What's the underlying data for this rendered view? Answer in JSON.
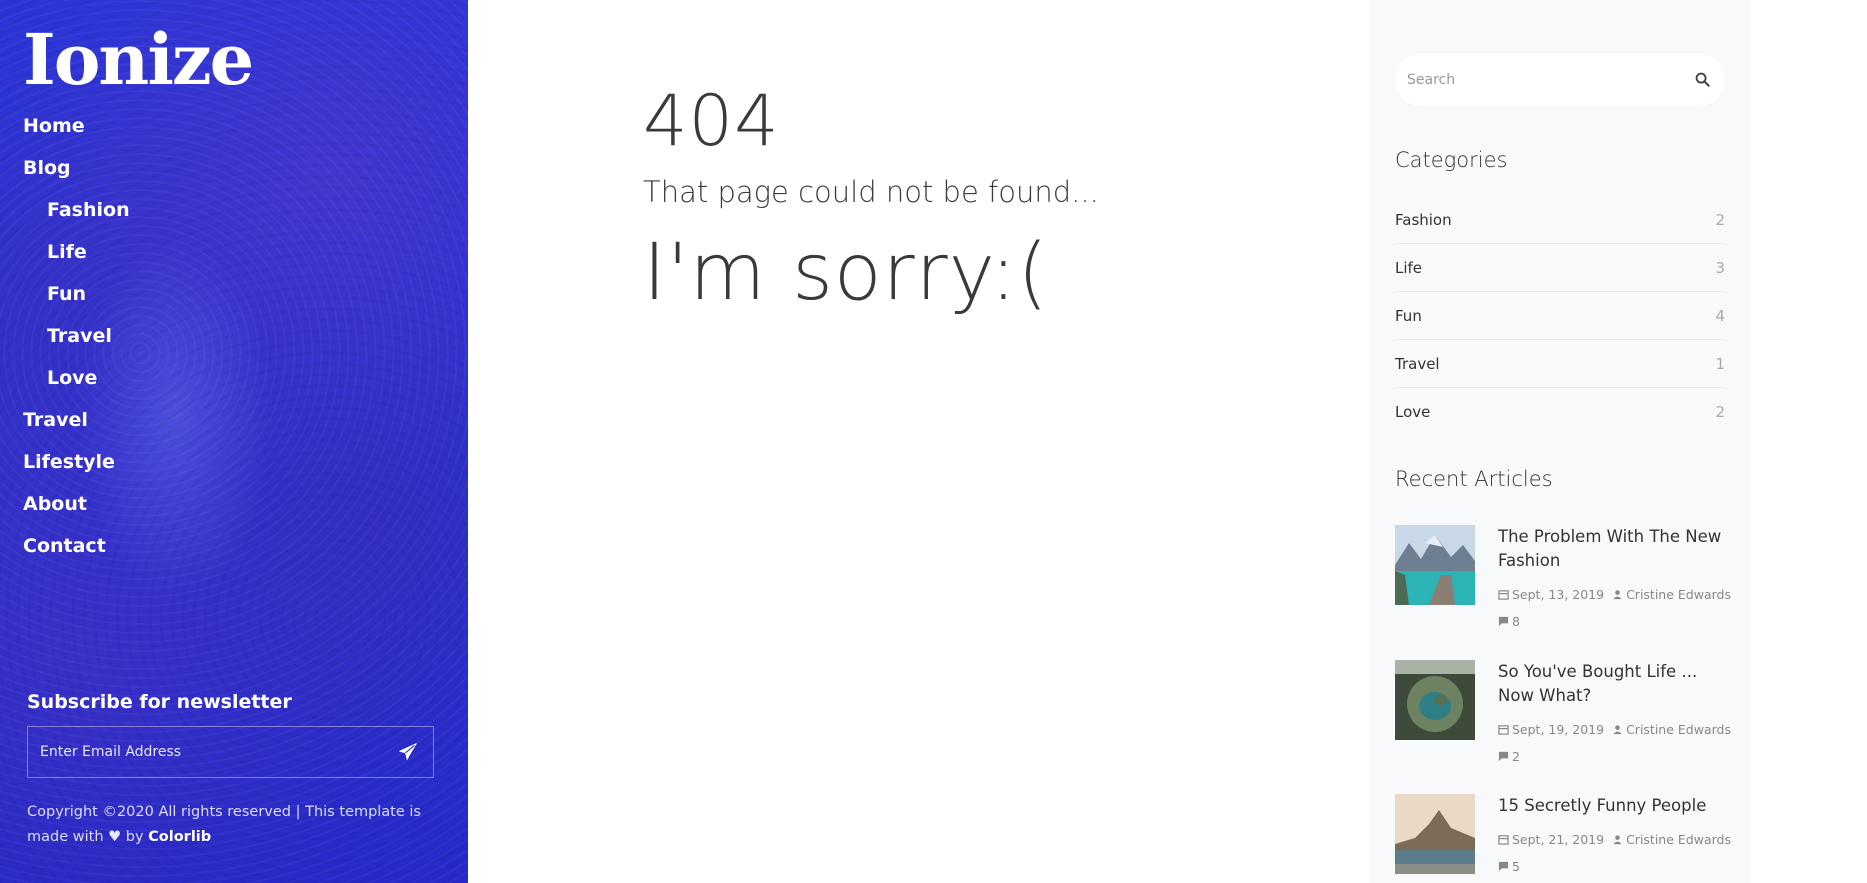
{
  "brand": {
    "logo": "Ionize"
  },
  "nav": {
    "items": [
      {
        "label": "Home",
        "sub": false
      },
      {
        "label": "Blog",
        "sub": false
      },
      {
        "label": "Fashion",
        "sub": true
      },
      {
        "label": "Life",
        "sub": true
      },
      {
        "label": "Fun",
        "sub": true
      },
      {
        "label": "Travel",
        "sub": true
      },
      {
        "label": "Love",
        "sub": true
      },
      {
        "label": "Travel",
        "sub": false
      },
      {
        "label": "Lifestyle",
        "sub": false
      },
      {
        "label": "About",
        "sub": false
      },
      {
        "label": "Contact",
        "sub": false
      }
    ]
  },
  "newsletter": {
    "title": "Subscribe for newsletter",
    "placeholder": "Enter Email Address"
  },
  "footer": {
    "copyright_prefix": "Copyright ©2020 All rights reserved | This template is made with",
    "by": "by",
    "link": "Colorlib"
  },
  "error": {
    "code": "404",
    "message": "That page could not be found...",
    "sorry": "I'm sorry:("
  },
  "search": {
    "placeholder": "Search"
  },
  "categories": {
    "title": "Categories",
    "items": [
      {
        "name": "Fashion",
        "count": "2"
      },
      {
        "name": "Life",
        "count": "3"
      },
      {
        "name": "Fun",
        "count": "4"
      },
      {
        "name": "Travel",
        "count": "1"
      },
      {
        "name": "Love",
        "count": "2"
      }
    ]
  },
  "recent": {
    "title": "Recent Articles",
    "articles": [
      {
        "title": "The Problem With The New Fashion",
        "date": "Sept, 13, 2019",
        "author": "Cristine Edwards",
        "comments": "8"
      },
      {
        "title": "So You've Bought Life ... Now What?",
        "date": "Sept, 19, 2019",
        "author": "Cristine Edwards",
        "comments": "2"
      },
      {
        "title": "15 Secretly Funny People",
        "date": "Sept, 21, 2019",
        "author": "Cristine Edwards",
        "comments": "5"
      }
    ]
  },
  "colors": {
    "sidebar_blue": "#2b35d6",
    "right_panel": "#f8f9fa",
    "text_dark": "#333333"
  }
}
